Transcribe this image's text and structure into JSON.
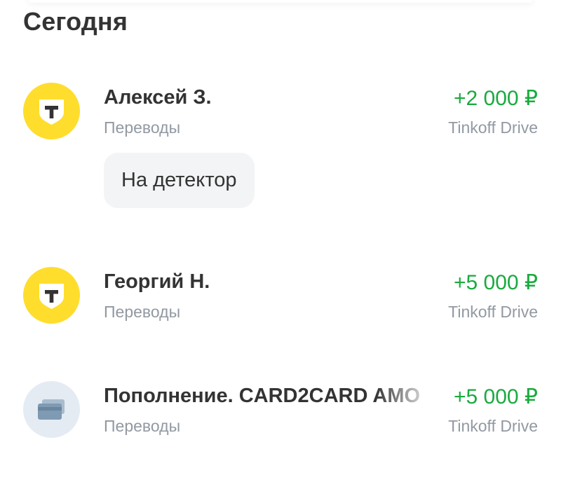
{
  "section": {
    "title": "Сегодня"
  },
  "operations": [
    {
      "avatar_icon": "tinkoff-logo-icon",
      "avatar_color": "#FFDD2D",
      "title": "Алексей З.",
      "category": "Переводы",
      "amount": "+2 000 ₽",
      "account": "Tinkoff Drive",
      "comment": "На детектор"
    },
    {
      "avatar_icon": "tinkoff-logo-icon",
      "avatar_color": "#FFDD2D",
      "title": "Георгий Н.",
      "category": "Переводы",
      "amount": "+5 000 ₽",
      "account": "Tinkoff Drive"
    },
    {
      "avatar_icon": "card-icon",
      "avatar_color": "#E4EBF3",
      "title": "Пополнение. CARD2CARD AMO",
      "category": "Переводы",
      "amount": "+5 000 ₽",
      "account": "Tinkoff Drive"
    }
  ],
  "colors": {
    "income": "#1AAA3F",
    "secondary_text": "#9299A2",
    "primary_text": "#333333",
    "brand_yellow": "#FFDD2D"
  }
}
